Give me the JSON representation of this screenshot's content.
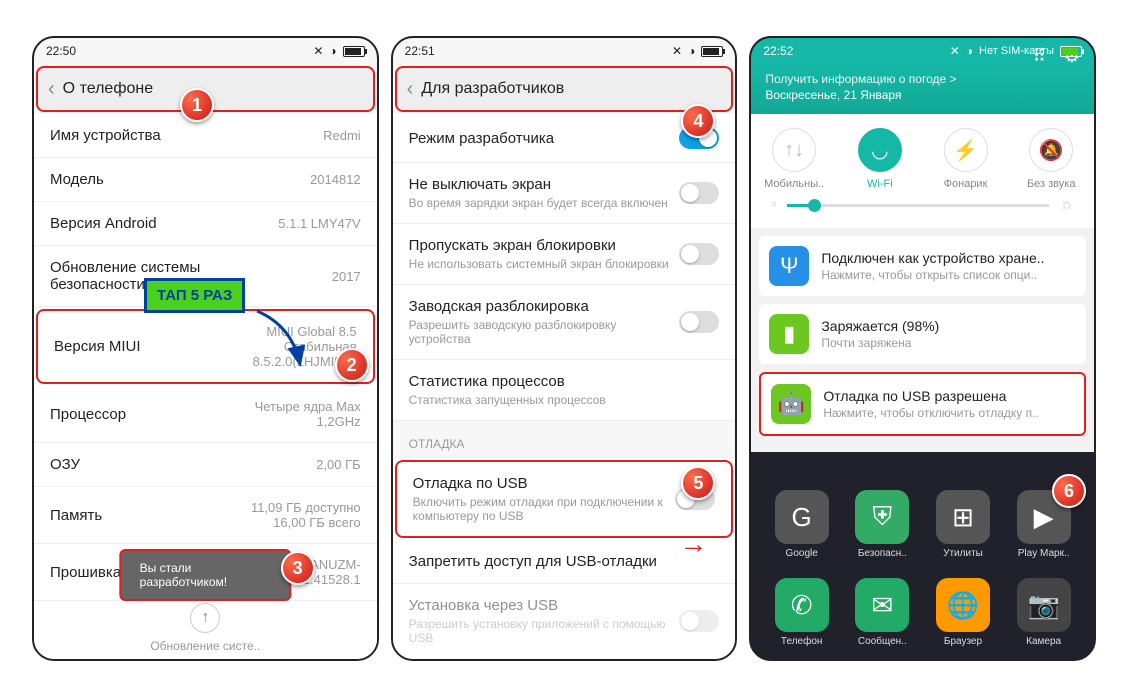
{
  "markers": [
    "1",
    "2",
    "3",
    "4",
    "5",
    "6"
  ],
  "tap_label": "ТАП 5 РАЗ",
  "p1": {
    "time": "22:50",
    "title": "О телефоне",
    "rows": {
      "device_name": {
        "l": "Имя устройства",
        "v": "Redmi"
      },
      "model": {
        "l": "Модель",
        "v": "2014812"
      },
      "android": {
        "l": "Версия Android",
        "v": "5.1.1 LMY47V"
      },
      "security": {
        "l": "Обновление системы безопасности Android",
        "v": "2017"
      },
      "miui": {
        "l": "Версия MIUI",
        "v": "MIUI Global 8.5\nСтабильная\n8.5.2.0(LHJMIED)"
      },
      "cpu": {
        "l": "Процессор",
        "v": "Четыре ядра Max\n1,2GHz"
      },
      "ram": {
        "l": "ОЗУ",
        "v": "2,00 ГБ"
      },
      "storage": {
        "l": "Память",
        "v": "11,09 ГБ доступно\n16,00 ГБ всего"
      },
      "firmware": {
        "l": "Прошивка",
        "v": "AANUZM-\n1.7.1.41528.1"
      }
    },
    "toast": "Вы стали разработчиком!",
    "update": "Обновление систе.."
  },
  "p2": {
    "time": "22:51",
    "title": "Для разработчиков",
    "rows": {
      "devmode": {
        "l": "Режим разработчика"
      },
      "noscreen": {
        "l": "Не выключать экран",
        "s": "Во время зарядки экран будет всегда включен"
      },
      "skiplock": {
        "l": "Пропускать экран блокировки",
        "s": "Не использовать системный экран блокировки"
      },
      "oemunlock": {
        "l": "Заводская разблокировка",
        "s": "Разрешить заводскую разблокировку устройства"
      },
      "procstat": {
        "l": "Статистика процессов",
        "s": "Статистика запущенных процессов"
      },
      "section": "ОТЛАДКА",
      "usbdebug": {
        "l": "Отладка по USB",
        "s": "Включить режим отладки при подключении к компьютеру по USB"
      },
      "revoke": {
        "l": "Запретить доступ для USB-отладки"
      },
      "usbinstall": {
        "l": "Установка через USB",
        "s": "Разрешить установку приложений с помощью USB"
      }
    }
  },
  "p3": {
    "time": "22:52",
    "nosim": "Нет SIM-карты",
    "weather": "Получить информацию о погоде >",
    "date": "Воскресенье, 21 Января",
    "qs": {
      "mobile": "Мобильны..",
      "wifi": "Wi-Fi",
      "torch": "Фонарик",
      "silent": "Без звука"
    },
    "notifs": {
      "usb": {
        "t": "Подключен как устройство хране..",
        "s": "Нажмите, чтобы открыть список опци.."
      },
      "charge": {
        "t": "Заряжается (98%)",
        "s": "Почти заряжена"
      },
      "debug": {
        "t": "Отладка по USB разрешена",
        "s": "Нажмите, чтобы отключить отладку п.."
      }
    },
    "apps": {
      "google": "Google",
      "security": "Безопасн..",
      "tools": "Утилиты",
      "play": "Play Марк.."
    },
    "dock": {
      "phone": "Телефон",
      "sms": "Сообщен..",
      "browser": "Браузер",
      "camera": "Камера"
    }
  }
}
